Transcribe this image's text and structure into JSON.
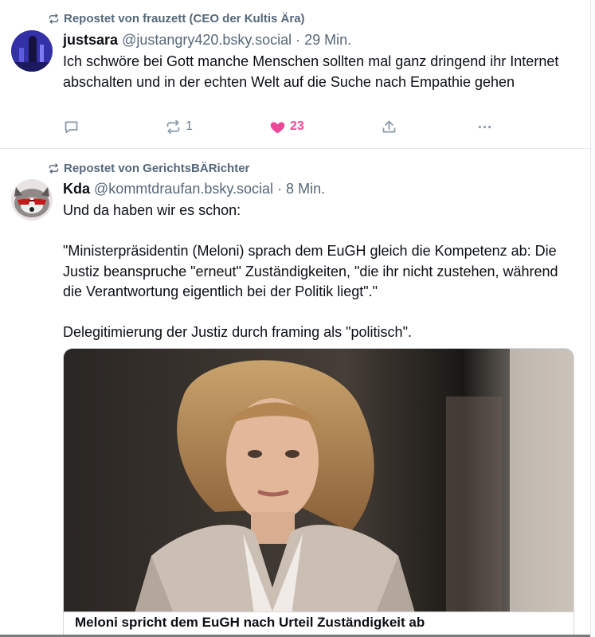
{
  "posts": [
    {
      "repost_label": "Repostet von frauzett (CEO der Kultis Ära)",
      "author_name": "justsara",
      "author_handle": "@justangry420.bsky.social",
      "time": " · 29 Min.",
      "text": "Ich schwöre bei Gott manche Menschen sollten mal ganz dringend ihr Internet abschalten und in der echten Welt auf die Suche nach Empathie gehen",
      "reposts": "1",
      "likes": "23"
    },
    {
      "repost_label": "Repostet von GerichtsBÄRichter",
      "author_name": "Kda",
      "author_handle": "@kommtdraufan.bsky.social",
      "time": " · 8 Min.",
      "paragraphs": [
        "Und da haben wir es schon:",
        "\"Ministerpräsidentin (Meloni) sprach dem EuGH gleich die Kompetenz ab: Die Justiz beanspruche \"erneut\" Zuständigkeiten, \"die ihr nicht zustehen, während die Verantwortung eigentlich bei der Politik liegt\".\"",
        "Delegitimierung der Justiz durch framing als \"politisch\"."
      ],
      "embed_title": "Meloni spricht dem EuGH nach Urteil Zuständigkeit ab"
    }
  ],
  "icons": {
    "repost": "repost-icon",
    "reply": "reply-icon",
    "like": "heart-icon",
    "share": "share-icon",
    "more": "more-icon"
  },
  "colors": {
    "like_active": "#ec4899",
    "muted_text": "#55677a",
    "divider": "#e3e8ee"
  }
}
